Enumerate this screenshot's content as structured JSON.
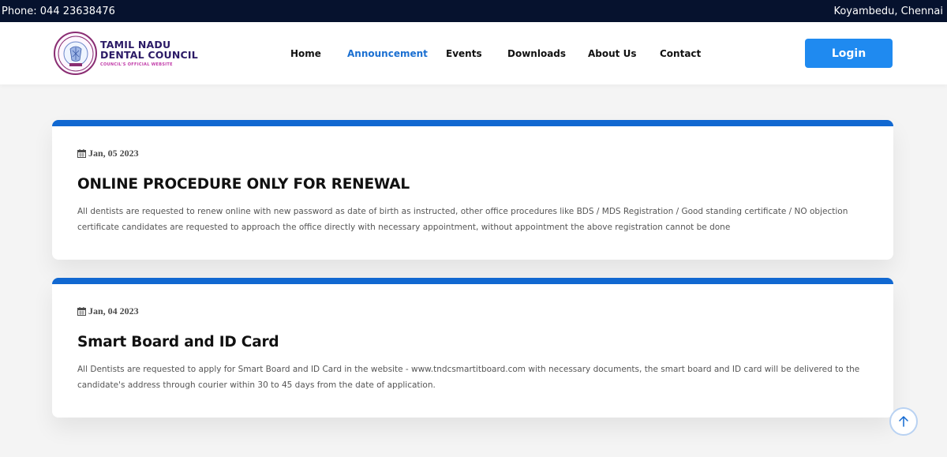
{
  "topbar": {
    "phone": "Phone: 044 23638476",
    "location": "Koyambedu, Chennai"
  },
  "logo": {
    "line1": "TAMIL NADU",
    "line2": "DENTAL COUNCIL",
    "tagline": "COUNCIL'S OFFICIAL WEBSITE",
    "seal_text": "TAMIL NADU DENTAL COUNCIL"
  },
  "nav": {
    "items": [
      {
        "label": "Home"
      },
      {
        "label": "Announcement",
        "active": true
      },
      {
        "label": "Events"
      },
      {
        "label": "Downloads"
      },
      {
        "label": "About Us"
      },
      {
        "label": "Contact"
      }
    ],
    "login_label": "Login"
  },
  "announcements": [
    {
      "date": "Jan, 05 2023",
      "title": "ONLINE PROCEDURE ONLY FOR RENEWAL",
      "body": "All dentists are requested to renew online with new password as date of birth as instructed, other office procedures like BDS / MDS Registration / Good standing certificate / NO objection certificate candidates are requested to approach the office directly with necessary appointment, without appointment the above registration cannot be done"
    },
    {
      "date": "Jan, 04 2023",
      "title": "Smart Board and ID Card",
      "body": "All Dentists are requested to apply for Smart Board and ID Card in the website - www.tndcsmartitboard.com with necessary documents, the smart board and ID card will be delivered to the candidate's address through courier within 30 to 45 days from the date of application."
    }
  ],
  "colors": {
    "topbar_bg": "#06122e",
    "accent": "#1168d1",
    "login_bg": "#1f8af0",
    "active_nav": "#1a6fd1"
  }
}
